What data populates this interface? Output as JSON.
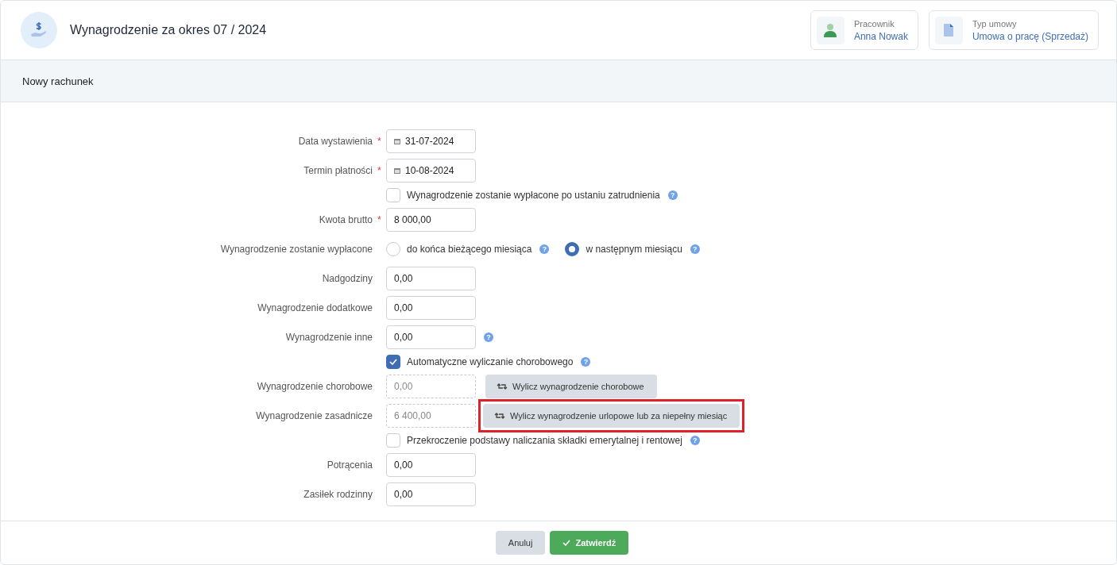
{
  "header": {
    "title": "Wynagrodzenie za okres 07 / 2024",
    "info_cards": [
      {
        "kind": "person",
        "caption": "Pracownik",
        "value": "Anna Nowak"
      },
      {
        "kind": "document",
        "caption": "Typ umowy",
        "value": "Umowa o pracę (Sprzedaż)"
      }
    ]
  },
  "section_title": "Nowy rachunek",
  "rows": [
    {
      "kind": "date",
      "label": "Data wystawienia",
      "required": "*",
      "value": "31-07-2024"
    },
    {
      "kind": "date",
      "label": "Termin płatności",
      "required": "*",
      "value": "10-08-2024"
    },
    {
      "kind": "checkbox",
      "label": "Wynagrodzenie zostanie wypłacone po ustaniu zatrudnienia",
      "checked": false,
      "help": "?"
    },
    {
      "kind": "input",
      "label": "Kwota brutto",
      "required": "*",
      "value": "8 000,00"
    },
    {
      "kind": "radio",
      "label": "Wynagrodzenie zostanie wypłacone",
      "options": [
        {
          "label": "do końca bieżącego miesiąca",
          "selected": false,
          "help": "?"
        },
        {
          "label": "w następnym miesiącu",
          "selected": true,
          "help": "?"
        }
      ]
    },
    {
      "kind": "input",
      "label": "Nadgodziny",
      "value": "0,00"
    },
    {
      "kind": "input",
      "label": "Wynagrodzenie dodatkowe",
      "value": "0,00"
    },
    {
      "kind": "input",
      "label": "Wynagrodzenie inne",
      "value": "0,00",
      "help": "?"
    },
    {
      "kind": "checkbox",
      "label": "Automatyczne wyliczanie chorobowego",
      "checked": true,
      "help": "?"
    },
    {
      "kind": "readonly",
      "label": "Wynagrodzenie chorobowe",
      "value": "0,00",
      "button": {
        "label": "Wylicz wynagrodzenie chorobowe",
        "highlighted": false
      }
    },
    {
      "kind": "readonly",
      "label": "Wynagrodzenie zasadnicze",
      "value": "6 400,00",
      "button": {
        "label": "Wylicz wynagrodzenie urlopowe lub za niepełny miesiąc",
        "highlighted": true
      }
    },
    {
      "kind": "checkbox",
      "label": "Przekroczenie podstawy naliczania składki emerytalnej i rentowej",
      "checked": false,
      "help": "?"
    },
    {
      "kind": "input",
      "label": "Potrącenia",
      "value": "0,00"
    },
    {
      "kind": "input",
      "label": "Zasiłek rodzinny",
      "value": "0,00"
    }
  ],
  "footer": {
    "cancel": "Anuluj",
    "confirm": "Zatwierdź"
  }
}
